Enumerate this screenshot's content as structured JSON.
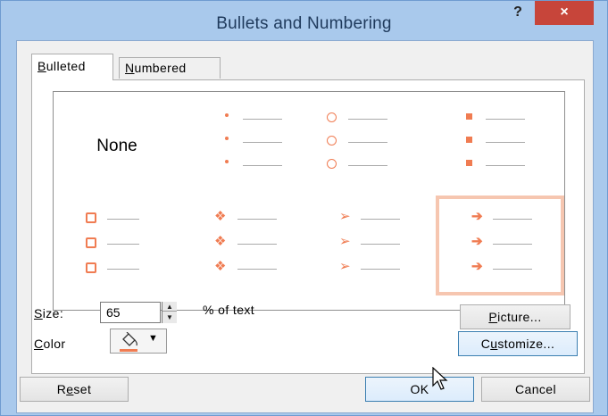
{
  "window": {
    "title": "Bullets and Numbering",
    "help_label": "?",
    "close_label": "×"
  },
  "tabs": [
    {
      "label": "Bulleted",
      "mnemonic": "B",
      "rest": "ulleted",
      "active": true
    },
    {
      "label": "Numbered",
      "mnemonic": "N",
      "rest": "umbered",
      "active": false
    }
  ],
  "gallery": {
    "none_label": "None",
    "bullet_color": "#f07c52",
    "selected_color": "#f6c6b0",
    "styles": [
      {
        "name": "none",
        "marker": "none-icon"
      },
      {
        "name": "small-dot",
        "marker": "small-dot-icon"
      },
      {
        "name": "hollow-circle",
        "marker": "hollow-circle-icon"
      },
      {
        "name": "filled-square",
        "marker": "filled-square-icon"
      },
      {
        "name": "hollow-square",
        "marker": "hollow-square-icon"
      },
      {
        "name": "diamond-cluster",
        "marker": "diamond-cluster-icon"
      },
      {
        "name": "arrowhead",
        "marker": "arrowhead-icon"
      },
      {
        "name": "arrow",
        "marker": "arrow-icon",
        "selected": true
      }
    ]
  },
  "size": {
    "label_mnemonic": "S",
    "label_rest": "ize:",
    "value": "65",
    "suffix": "% of text"
  },
  "color": {
    "label_mnemonic": "C",
    "label_rest": "olor",
    "value": "#f07c52",
    "icon": "paint-bucket-icon"
  },
  "buttons": {
    "picture": {
      "mnemonic": "P",
      "rest": "icture..."
    },
    "customize": {
      "pre": "C",
      "mnemonic": "u",
      "rest": "stomize..."
    },
    "reset": {
      "pre": "R",
      "mnemonic": "e",
      "rest": "set"
    },
    "ok": "OK",
    "cancel": "Cancel"
  }
}
